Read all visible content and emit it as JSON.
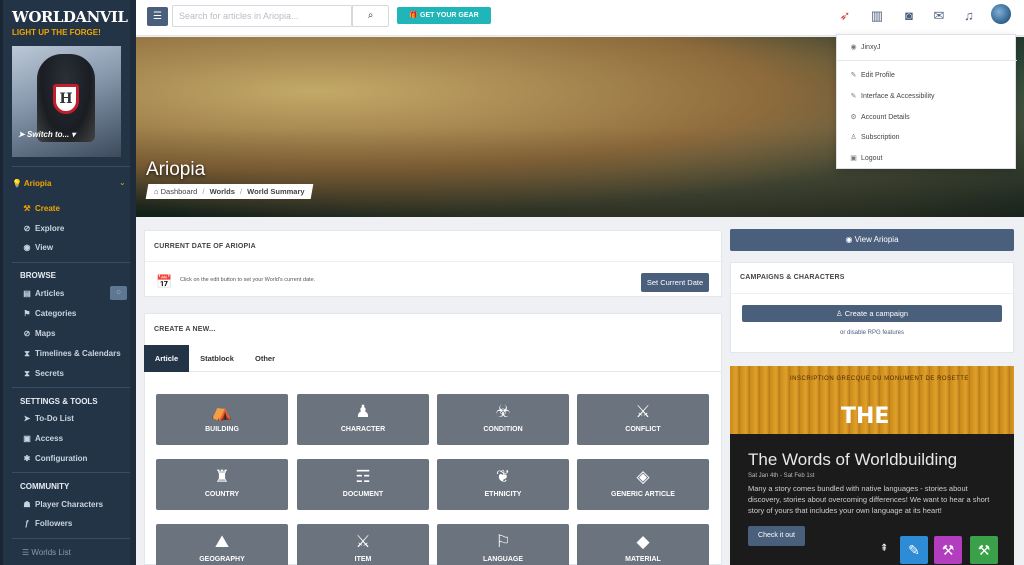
{
  "sidebar": {
    "logo": "WORLDANVIL",
    "tagline": "LIGHT UP THE FORGE!",
    "switch_to": "Switch to...",
    "world_name": "Ariopia",
    "nav_main": [
      {
        "label": "Create",
        "icon": "hammer-icon",
        "glyph": "⚒"
      },
      {
        "label": "Explore",
        "icon": "compass-icon",
        "glyph": "⊘"
      },
      {
        "label": "View",
        "icon": "eye-icon",
        "glyph": "◉"
      }
    ],
    "browse_title": "BROWSE",
    "browse": [
      {
        "label": "Articles",
        "icon": "book-icon",
        "glyph": "▤"
      },
      {
        "label": "Categories",
        "icon": "scroll-icon",
        "glyph": "⚑"
      },
      {
        "label": "Maps",
        "icon": "map-icon",
        "glyph": "⊘"
      },
      {
        "label": "Timelines & Calendars",
        "icon": "hourglass-icon",
        "glyph": "⧗"
      },
      {
        "label": "Secrets",
        "icon": "hourglass-icon",
        "glyph": "⧗"
      }
    ],
    "settings_title": "SETTINGS & TOOLS",
    "settings": [
      {
        "label": "To-Do List",
        "icon": "arrow-icon",
        "glyph": "➤"
      },
      {
        "label": "Access",
        "icon": "lock-icon",
        "glyph": "🔒"
      },
      {
        "label": "Configuration",
        "icon": "gear-icon",
        "glyph": "✱"
      }
    ],
    "community_title": "COMMUNITY",
    "community": [
      {
        "label": "Player Characters",
        "icon": "users-icon",
        "glyph": "👥"
      },
      {
        "label": "Followers",
        "icon": "feather-icon",
        "glyph": "ƒ"
      }
    ],
    "worlds_list": "Worlds List"
  },
  "topbar": {
    "search_placeholder": "Search for articles in Ariopia...",
    "gear_label": "GET YOUR GEAR"
  },
  "banner": {
    "title": "Ariopia",
    "breadcrumb": [
      "Dashboard",
      "Worlds",
      "World Summary"
    ]
  },
  "user_menu": {
    "username": "JinxyJ",
    "items": [
      {
        "label": "Edit Profile",
        "glyph": "✎"
      },
      {
        "label": "Interface & Accessibility",
        "glyph": "✎"
      },
      {
        "label": "Account Details",
        "glyph": "⚙"
      },
      {
        "label": "Subscription",
        "glyph": "♙"
      },
      {
        "label": "Logout",
        "glyph": "🔒"
      }
    ]
  },
  "current_date": {
    "title": "CURRENT DATE OF ARIOPIA",
    "hint": "Click on the edit button to set your World's current date.",
    "button": "Set Current Date"
  },
  "create_new": {
    "title": "CREATE A NEW...",
    "tabs": [
      "Article",
      "Statblock",
      "Other"
    ],
    "tiles": [
      {
        "label": "BUILDING",
        "icon": "tent-icon",
        "glyph": "⛺"
      },
      {
        "label": "CHARACTER",
        "icon": "person-icon",
        "glyph": "♟"
      },
      {
        "label": "CONDITION",
        "icon": "biohazard-icon",
        "glyph": "☣"
      },
      {
        "label": "CONFLICT",
        "icon": "swords-icon",
        "glyph": "⚔"
      },
      {
        "label": "COUNTRY",
        "icon": "castle-icon",
        "glyph": "♜"
      },
      {
        "label": "DOCUMENT",
        "icon": "scroll-icon",
        "glyph": "📜"
      },
      {
        "label": "ETHNICITY",
        "icon": "footprint-icon",
        "glyph": "👣"
      },
      {
        "label": "GENERIC ARTICLE",
        "icon": "book-icon",
        "glyph": "📖"
      },
      {
        "label": "GEOGRAPHY",
        "icon": "mountain-icon",
        "glyph": "⛰"
      },
      {
        "label": "ITEM",
        "icon": "sword-icon",
        "glyph": "🗡"
      },
      {
        "label": "LANGUAGE",
        "icon": "signpost-icon",
        "glyph": "⚐"
      },
      {
        "label": "MATERIAL",
        "icon": "ingot-icon",
        "glyph": "◆"
      }
    ]
  },
  "right": {
    "view_button": "View Ariopia",
    "campaigns_title": "CAMPAIGNS & CHARACTERS",
    "create_campaign": "Create a campaign",
    "disable_rpg": "or disable RPG features"
  },
  "promo": {
    "inscription": "INSCRIPTION GRECQUE DU MONUMENT DE ROSETTE",
    "the": "THE",
    "title": "The Words of Worldbuilding",
    "date": "Sat Jan 4th - Sat Feb 1st",
    "description": "Many a story comes bundled with native languages - stories about discovery, stories about overcoming differences! We want to hear a short story of yours that includes your own language at its heart!",
    "button": "Check it out"
  }
}
